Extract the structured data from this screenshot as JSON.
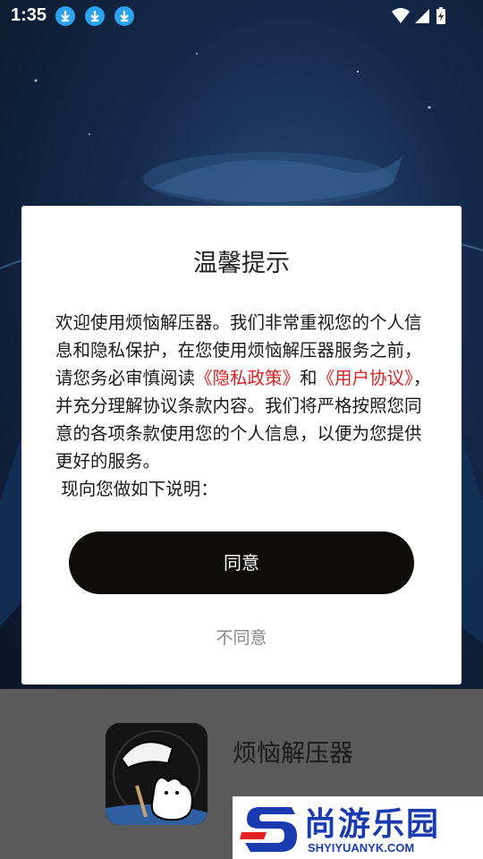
{
  "status_bar": {
    "time": "1:35",
    "download_icons": [
      "download-icon",
      "download-icon",
      "download-icon"
    ],
    "wifi": "wifi-icon",
    "signal": "signal-icon",
    "battery": "battery-charging-icon"
  },
  "dialog": {
    "title": "温馨提示",
    "body_intro": "欢迎使用烦恼解压器。我们非常重视您的个人信息和隐私保护，在您使用烦恼解压器服务之前，请您务必审慎阅读",
    "privacy_link": "《隐私政策》",
    "and": "和",
    "user_agreement_link": "《用户协议》",
    "body_rest": "，并充分理解协议条款内容。我们将严格按照您同意的各项条款使用您的个人信息，以便为您提供更好的服务。",
    "body_note": "现向您做如下说明：",
    "agree_button": "同意",
    "disagree_button": "不同意"
  },
  "app": {
    "name": "烦恼解压器"
  },
  "watermark": {
    "brand_text": "尚游乐园",
    "url": "SHYIYUANYK.COM"
  },
  "colors": {
    "link": "#e02020",
    "primary_button": "#0f0d0c",
    "download_badge": "#2aa3f0",
    "watermark": "#1a3bb0"
  }
}
